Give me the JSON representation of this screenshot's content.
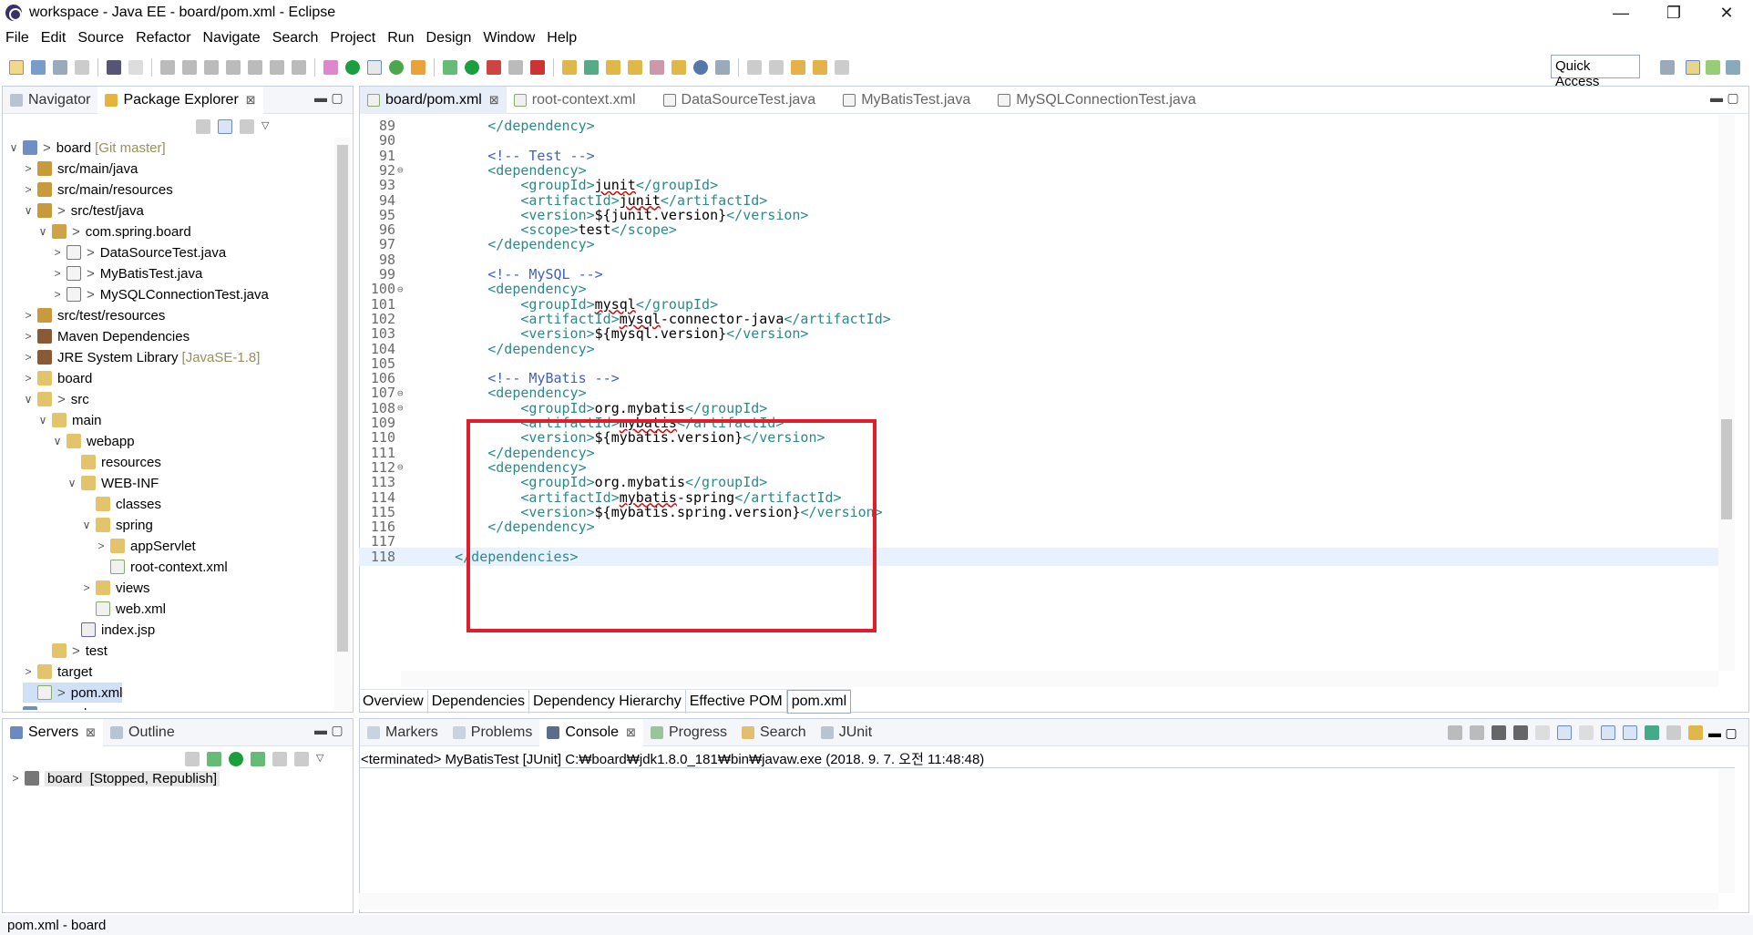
{
  "window": {
    "title": "workspace - Java EE - board/pom.xml - Eclipse",
    "minimize": "—",
    "restore": "❐",
    "close": "✕"
  },
  "menu": [
    "File",
    "Edit",
    "Source",
    "Refactor",
    "Navigate",
    "Search",
    "Project",
    "Run",
    "Design",
    "Window",
    "Help"
  ],
  "toolbar": {
    "quick_access": "Quick Access"
  },
  "left_panel": {
    "tabs": [
      {
        "label": "Navigator",
        "active": false
      },
      {
        "label": "Package Explorer",
        "active": true,
        "close": "⊠"
      }
    ],
    "tree": [
      {
        "label": "board",
        "decoration": "[Git master]",
        "gt": ">",
        "twisty": "v",
        "depth": 0,
        "icon": "project-icon"
      },
      {
        "label": "src/main/java",
        "twisty": ">",
        "depth": 1,
        "icon": "package-root-icon"
      },
      {
        "label": "src/main/resources",
        "twisty": ">",
        "depth": 1,
        "icon": "package-root-icon"
      },
      {
        "label": "src/test/java",
        "gt": ">",
        "twisty": "v",
        "depth": 1,
        "icon": "package-root-icon"
      },
      {
        "label": "com.spring.board",
        "gt": ">",
        "twisty": "v",
        "depth": 2,
        "icon": "package-icon"
      },
      {
        "label": "DataSourceTest.java",
        "gt": ">",
        "twisty": ">",
        "depth": 3,
        "icon": "java-file-icon"
      },
      {
        "label": "MyBatisTest.java",
        "gt": ">",
        "twisty": ">",
        "depth": 3,
        "icon": "java-file-icon"
      },
      {
        "label": "MySQLConnectionTest.java",
        "gt": ">",
        "twisty": ">",
        "depth": 3,
        "icon": "java-file-icon"
      },
      {
        "label": "src/test/resources",
        "twisty": ">",
        "depth": 1,
        "icon": "package-root-icon"
      },
      {
        "label": "Maven Dependencies",
        "twisty": ">",
        "depth": 1,
        "icon": "library-icon"
      },
      {
        "label": "JRE System Library",
        "decoration": "[JavaSE-1.8]",
        "twisty": ">",
        "depth": 1,
        "icon": "library-icon"
      },
      {
        "label": "board",
        "twisty": ">",
        "depth": 1,
        "icon": "folder-icon"
      },
      {
        "label": "src",
        "gt": ">",
        "twisty": "v",
        "depth": 1,
        "icon": "folder-icon"
      },
      {
        "label": "main",
        "twisty": "v",
        "depth": 2,
        "icon": "folder-icon"
      },
      {
        "label": "webapp",
        "twisty": "v",
        "depth": 3,
        "icon": "folder-icon"
      },
      {
        "label": "resources",
        "twisty": "",
        "depth": 4,
        "icon": "folder-icon"
      },
      {
        "label": "WEB-INF",
        "twisty": "v",
        "depth": 4,
        "icon": "folder-icon"
      },
      {
        "label": "classes",
        "twisty": "",
        "depth": 5,
        "icon": "folder-icon"
      },
      {
        "label": "spring",
        "twisty": "v",
        "depth": 5,
        "icon": "folder-icon"
      },
      {
        "label": "appServlet",
        "twisty": ">",
        "depth": 6,
        "icon": "folder-icon"
      },
      {
        "label": "root-context.xml",
        "twisty": "",
        "depth": 6,
        "icon": "xml-file-icon"
      },
      {
        "label": "views",
        "twisty": ">",
        "depth": 5,
        "icon": "folder-icon"
      },
      {
        "label": "web.xml",
        "twisty": "",
        "depth": 5,
        "icon": "xml-file-icon"
      },
      {
        "label": "index.jsp",
        "twisty": "",
        "depth": 4,
        "icon": "jsp-file-icon"
      },
      {
        "label": "test",
        "gt": ">",
        "twisty": "",
        "depth": 2,
        "icon": "folder-icon"
      },
      {
        "label": "target",
        "twisty": ">",
        "depth": 1,
        "icon": "folder-icon"
      },
      {
        "label": "pom.xml",
        "gt": ">",
        "twisty": "",
        "depth": 1,
        "icon": "xml-file-icon",
        "selected": true
      },
      {
        "label": "example",
        "twisty": ">",
        "depth": 0,
        "icon": "project-icon",
        "partial": true
      }
    ]
  },
  "servers_panel": {
    "tabs": [
      {
        "label": "Servers",
        "active": true,
        "close": "⊠"
      },
      {
        "label": "Outline",
        "active": false
      }
    ],
    "rows": [
      {
        "label": "board",
        "status": "[Stopped, Republish]"
      }
    ]
  },
  "editor": {
    "tabs": [
      {
        "label": "board/pom.xml",
        "active": true,
        "close": "⊠"
      },
      {
        "label": "root-context.xml",
        "active": false
      },
      {
        "label": "DataSourceTest.java",
        "active": false
      },
      {
        "label": "MyBatisTest.java",
        "active": false
      },
      {
        "label": "MySQLConnectionTest.java",
        "active": false
      }
    ],
    "lines": [
      {
        "n": "89",
        "indent": "        ",
        "parts": [
          {
            "t": "</dependency>",
            "c": "tag"
          }
        ]
      },
      {
        "n": "90",
        "indent": "",
        "parts": []
      },
      {
        "n": "91",
        "indent": "        ",
        "parts": [
          {
            "t": "<!-- Test -->",
            "c": "cmt"
          }
        ]
      },
      {
        "n": "92",
        "fold": "⊖",
        "indent": "        ",
        "parts": [
          {
            "t": "<dependency>",
            "c": "tag"
          }
        ]
      },
      {
        "n": "93",
        "indent": "            ",
        "parts": [
          {
            "t": "<groupId>",
            "c": "tag"
          },
          {
            "t": "junit",
            "c": "txt err"
          },
          {
            "t": "</groupId>",
            "c": "tag"
          }
        ]
      },
      {
        "n": "94",
        "indent": "            ",
        "parts": [
          {
            "t": "<artifactId>",
            "c": "tag"
          },
          {
            "t": "junit",
            "c": "txt err"
          },
          {
            "t": "</artifactId>",
            "c": "tag"
          }
        ]
      },
      {
        "n": "95",
        "indent": "            ",
        "parts": [
          {
            "t": "<version>",
            "c": "tag"
          },
          {
            "t": "${junit.version}",
            "c": "txt"
          },
          {
            "t": "</version>",
            "c": "tag"
          }
        ]
      },
      {
        "n": "96",
        "indent": "            ",
        "parts": [
          {
            "t": "<scope>",
            "c": "tag"
          },
          {
            "t": "test",
            "c": "txt"
          },
          {
            "t": "</scope>",
            "c": "tag"
          }
        ]
      },
      {
        "n": "97",
        "indent": "        ",
        "parts": [
          {
            "t": "</dependency>",
            "c": "tag"
          }
        ]
      },
      {
        "n": "98",
        "indent": "",
        "parts": []
      },
      {
        "n": "99",
        "indent": "        ",
        "parts": [
          {
            "t": "<!-- MySQL -->",
            "c": "cmt"
          }
        ]
      },
      {
        "n": "100",
        "fold": "⊖",
        "indent": "        ",
        "parts": [
          {
            "t": "<dependency>",
            "c": "tag"
          }
        ]
      },
      {
        "n": "101",
        "indent": "            ",
        "parts": [
          {
            "t": "<groupId>",
            "c": "tag"
          },
          {
            "t": "mysql",
            "c": "txt err"
          },
          {
            "t": "</groupId>",
            "c": "tag"
          }
        ]
      },
      {
        "n": "102",
        "indent": "            ",
        "parts": [
          {
            "t": "<artifactId>",
            "c": "tag"
          },
          {
            "t": "mysql",
            "c": "txt err"
          },
          {
            "t": "-connector-java",
            "c": "txt"
          },
          {
            "t": "</artifactId>",
            "c": "tag"
          }
        ]
      },
      {
        "n": "103",
        "indent": "            ",
        "parts": [
          {
            "t": "<version>",
            "c": "tag"
          },
          {
            "t": "${mysql.version}",
            "c": "txt"
          },
          {
            "t": "</version>",
            "c": "tag"
          }
        ]
      },
      {
        "n": "104",
        "indent": "        ",
        "parts": [
          {
            "t": "</dependency>",
            "c": "tag"
          }
        ]
      },
      {
        "n": "105",
        "indent": "",
        "parts": []
      },
      {
        "n": "106",
        "indent": "        ",
        "parts": [
          {
            "t": "<!-- MyBatis -->",
            "c": "cmt"
          }
        ]
      },
      {
        "n": "107",
        "fold": "⊖",
        "indent": "        ",
        "parts": [
          {
            "t": "<dependency>",
            "c": "tag"
          }
        ]
      },
      {
        "n": "108",
        "fold": "⊖",
        "indent": "            ",
        "parts": [
          {
            "t": "<groupId>",
            "c": "tag"
          },
          {
            "t": "org.mybatis",
            "c": "txt"
          },
          {
            "t": "</groupId>",
            "c": "tag"
          }
        ]
      },
      {
        "n": "109",
        "indent": "            ",
        "parts": [
          {
            "t": "<artifactId>",
            "c": "tag"
          },
          {
            "t": "mybatis",
            "c": "txt err"
          },
          {
            "t": "</artifactId>",
            "c": "tag"
          }
        ]
      },
      {
        "n": "110",
        "indent": "            ",
        "parts": [
          {
            "t": "<version>",
            "c": "tag"
          },
          {
            "t": "${mybatis.version}",
            "c": "txt"
          },
          {
            "t": "</version>",
            "c": "tag"
          }
        ]
      },
      {
        "n": "111",
        "indent": "        ",
        "parts": [
          {
            "t": "</dependency>",
            "c": "tag"
          }
        ]
      },
      {
        "n": "112",
        "fold": "⊖",
        "indent": "        ",
        "parts": [
          {
            "t": "<dependency>",
            "c": "tag"
          }
        ]
      },
      {
        "n": "113",
        "indent": "            ",
        "parts": [
          {
            "t": "<groupId>",
            "c": "tag"
          },
          {
            "t": "org.mybatis",
            "c": "txt"
          },
          {
            "t": "</groupId>",
            "c": "tag"
          }
        ]
      },
      {
        "n": "114",
        "indent": "            ",
        "parts": [
          {
            "t": "<artifactId>",
            "c": "tag"
          },
          {
            "t": "mybatis",
            "c": "txt err"
          },
          {
            "t": "-spring",
            "c": "txt"
          },
          {
            "t": "</artifactId>",
            "c": "tag"
          }
        ]
      },
      {
        "n": "115",
        "indent": "            ",
        "parts": [
          {
            "t": "<version>",
            "c": "tag"
          },
          {
            "t": "${mybatis.spring.version}",
            "c": "txt"
          },
          {
            "t": "</version>",
            "c": "tag"
          }
        ]
      },
      {
        "n": "116",
        "indent": "        ",
        "parts": [
          {
            "t": "</dependency>",
            "c": "tag"
          }
        ]
      },
      {
        "n": "117",
        "indent": "",
        "parts": []
      },
      {
        "n": "118",
        "indent": "    ",
        "current": true,
        "parts": [
          {
            "t": "</dependencies>",
            "c": "tag"
          }
        ]
      }
    ],
    "bottom_tabs": [
      {
        "label": "Overview",
        "active": false
      },
      {
        "label": "Dependencies",
        "active": false
      },
      {
        "label": "Dependency Hierarchy",
        "active": false
      },
      {
        "label": "Effective POM",
        "active": false
      },
      {
        "label": "pom.xml",
        "active": true
      }
    ]
  },
  "console_panel": {
    "tabs": [
      {
        "label": "Markers",
        "active": false
      },
      {
        "label": "Problems",
        "active": false
      },
      {
        "label": "Console",
        "active": true,
        "close": "⊠"
      },
      {
        "label": "Progress",
        "active": false
      },
      {
        "label": "Search",
        "active": false
      },
      {
        "label": "JUnit",
        "active": false
      }
    ],
    "status_line": "<terminated> MyBatisTest [JUnit] C:₩board₩jdk1.8.0_181₩bin₩javaw.exe (2018. 9. 7. 오전 11:48:48)"
  },
  "statusbar": {
    "text": "pom.xml - board"
  },
  "colors": {
    "xml_tag": "#2a8a8a",
    "xml_comment": "#3f5fbf",
    "highlight_box": "#e01d2a",
    "selection": "#cfe0f7"
  }
}
